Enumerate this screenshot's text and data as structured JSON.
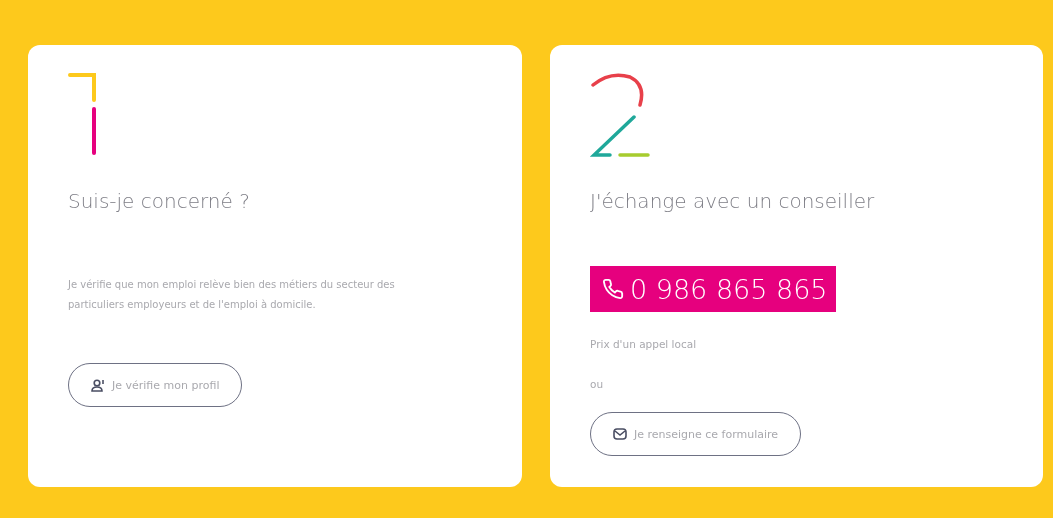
{
  "cards": [
    {
      "kind": "first",
      "title": "Suis-je concerné ?",
      "description": "Je vérifie que mon emploi relève bien des métiers du secteur des particuliers employeurs et de l'emploi à domicile.",
      "button": {
        "label": "Je vérifie mon profil",
        "kind": "profile"
      }
    },
    {
      "kind": "second",
      "title": "J'échange avec un conseiller",
      "phone": "0 986 865 865",
      "note": "Prix d'un appel local",
      "separator": "ou",
      "button": {
        "label": "Je renseigne ce formulaire",
        "kind": "form"
      }
    }
  ]
}
